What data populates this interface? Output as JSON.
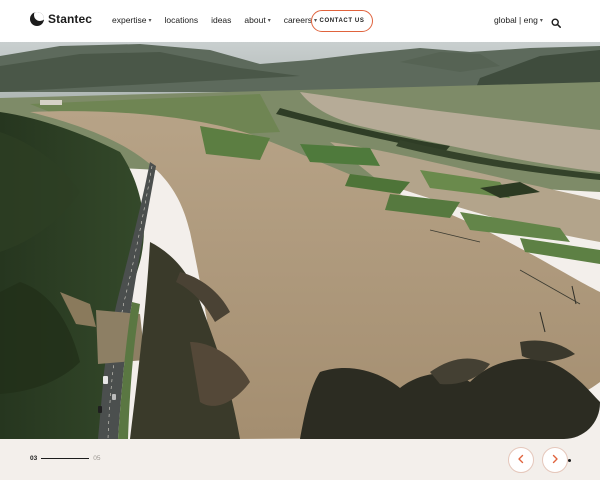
{
  "brand": {
    "name": "Stantec",
    "logo_icon": "stantec-logo-icon"
  },
  "nav": {
    "items": [
      {
        "label": "expertise",
        "has_dropdown": true
      },
      {
        "label": "locations",
        "has_dropdown": false
      },
      {
        "label": "ideas",
        "has_dropdown": false
      },
      {
        "label": "about",
        "has_dropdown": true
      },
      {
        "label": "careers",
        "has_dropdown": true
      }
    ],
    "contact_label": "CONTACT US",
    "language_label": "global | eng",
    "search_icon": "search-icon"
  },
  "hero": {
    "image_icon": "flooded-valley-aerial-photo"
  },
  "carousel": {
    "current": "03",
    "total": "05",
    "prev_icon": "chevron-left-icon",
    "next_icon": "chevron-right-icon"
  },
  "colors": {
    "accent": "#e0633d",
    "background": "#f3efeb",
    "header": "#ffffff",
    "text": "#1c1c1c"
  }
}
